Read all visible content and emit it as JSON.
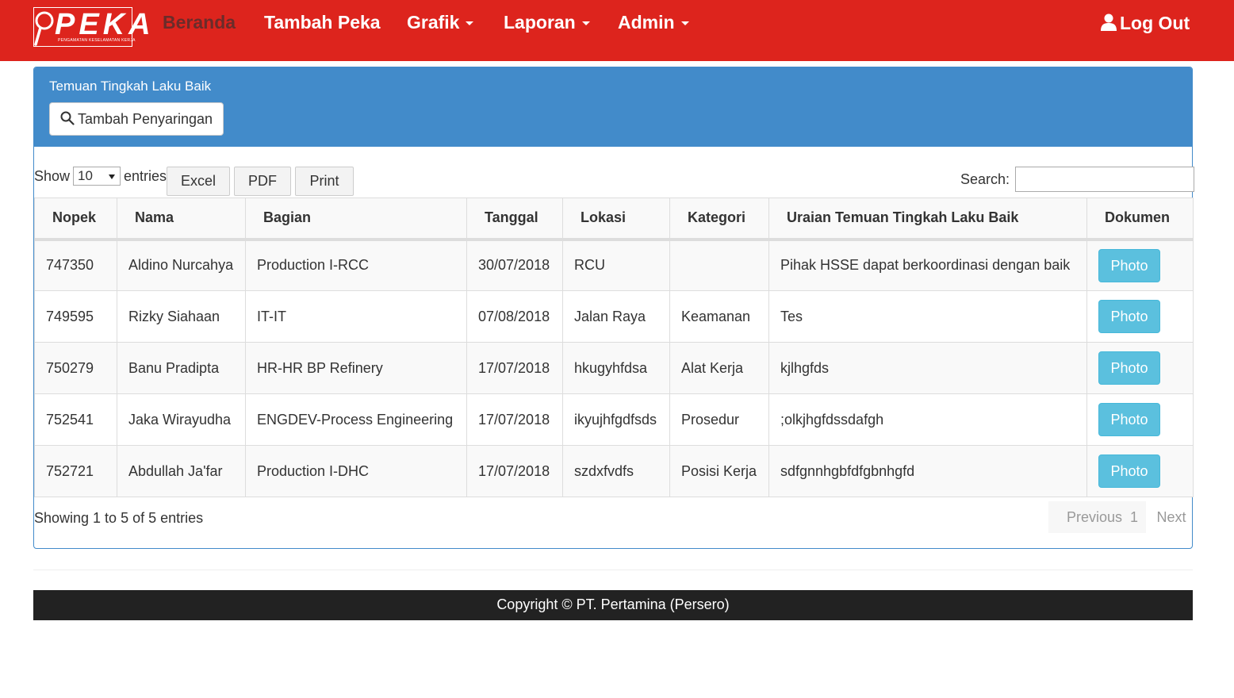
{
  "brand": {
    "logo_text": "PEKA",
    "logo_subtitle": "PENGAMATAN KESELAMATAN KERJA",
    "color": "#dd241d"
  },
  "nav": {
    "beranda": "Beranda",
    "tambah_peka": "Tambah Peka",
    "grafik": "Grafik",
    "laporan": "Laporan",
    "admin": "Admin",
    "logout": "Log Out"
  },
  "panel": {
    "title": "Temuan Tingkah Laku Baik",
    "filter_button": "Tambah Penyaringan",
    "header_color": "#428bca"
  },
  "table_controls": {
    "show_label": "Show",
    "length_value": "10",
    "entries_label": "entries",
    "excel": "Excel",
    "pdf": "PDF",
    "print": "Print",
    "search_label": "Search:",
    "search_value": ""
  },
  "table": {
    "headers": [
      "Nopek",
      "Nama",
      "Bagian",
      "Tanggal",
      "Lokasi",
      "Kategori",
      "Uraian Temuan Tingkah Laku Baik",
      "Dokumen"
    ],
    "rows": [
      [
        "747350",
        "Aldino Nurcahya",
        "Production I-RCC",
        "30/07/2018",
        "RCU",
        "",
        "Pihak HSSE dapat berkoordinasi dengan baik",
        "Photo"
      ],
      [
        "749595",
        "Rizky Siahaan",
        "IT-IT",
        "07/08/2018",
        "Jalan Raya",
        "Keamanan",
        "Tes",
        "Photo"
      ],
      [
        "750279",
        "Banu Pradipta",
        "HR-HR BP Refinery",
        "17/07/2018",
        "hkugyhfdsa",
        "Alat Kerja",
        "kjlhgfds",
        "Photo"
      ],
      [
        "752541",
        "Jaka Wirayudha",
        "ENGDEV-Process Engineering",
        "17/07/2018",
        "ikyujhfgdfsds",
        "Prosedur",
        ";olkjhgfdssdafgh",
        "Photo"
      ],
      [
        "752721",
        "Abdullah Ja'far",
        "Production I-DHC",
        "17/07/2018",
        "szdxfvdfs",
        "Posisi Kerja",
        "sdfgnnhgbfdfgbnhgfd",
        "Photo"
      ]
    ]
  },
  "pagination": {
    "info": "Showing 1 to 5 of 5 entries",
    "previous": "Previous",
    "page": "1",
    "next": "Next"
  },
  "footer": {
    "copyright": "Copyright © PT. Pertamina (Persero)"
  }
}
